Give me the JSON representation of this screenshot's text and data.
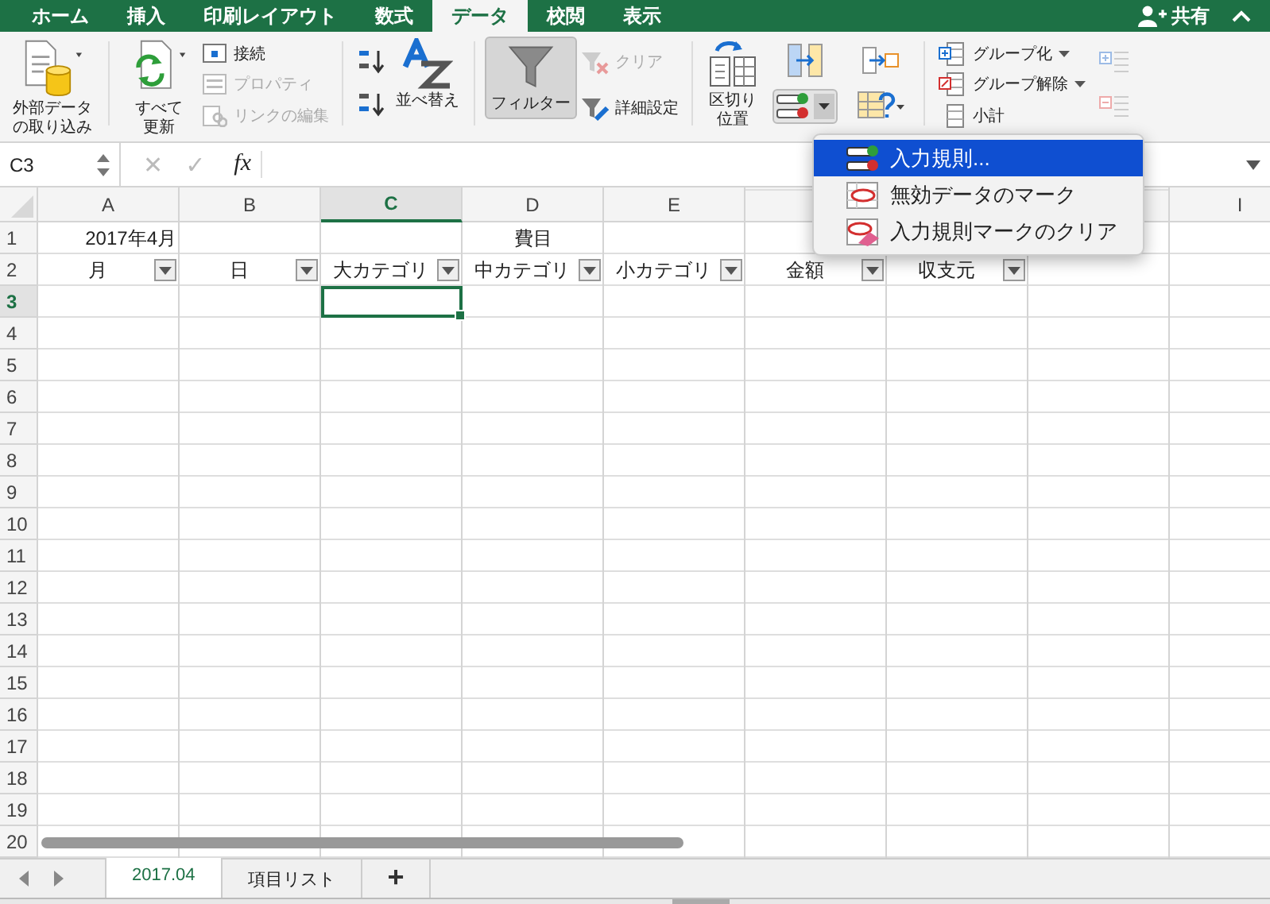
{
  "tabs": [
    {
      "label": "ホーム",
      "selected": false
    },
    {
      "label": "挿入",
      "selected": false
    },
    {
      "label": "印刷レイアウト",
      "selected": false
    },
    {
      "label": "数式",
      "selected": false
    },
    {
      "label": "データ",
      "selected": true
    },
    {
      "label": "校閲",
      "selected": false
    },
    {
      "label": "表示",
      "selected": false
    }
  ],
  "share": {
    "label": "共有"
  },
  "ribbon": {
    "get_external": {
      "label": "外部データの取り込み"
    },
    "refresh_all": {
      "label": "すべて更新"
    },
    "connections": [
      {
        "label": "接続",
        "disabled": false
      },
      {
        "label": "プロパティ",
        "disabled": true
      },
      {
        "label": "リンクの編集",
        "disabled": true
      }
    ],
    "sort": {
      "label": "並べ替え"
    },
    "filter": {
      "label": "フィルター",
      "selected": true
    },
    "clear": {
      "label": "クリア",
      "disabled": true
    },
    "advanced": {
      "label": "詳細設定",
      "disabled": false
    },
    "text_to_columns": {
      "label": "区切り位置"
    },
    "data_validation": {
      "expanded": true
    },
    "outline": [
      {
        "label": "グループ化",
        "dropdown": true
      },
      {
        "label": "グループ解除",
        "dropdown": true
      },
      {
        "label": "小計",
        "dropdown": false
      }
    ]
  },
  "formula_bar": {
    "name_box": "C3",
    "cancel": "✕",
    "enter": "✓",
    "fx": "fx"
  },
  "columns": [
    {
      "label": "A",
      "selected": false
    },
    {
      "label": "B",
      "selected": false
    },
    {
      "label": "C",
      "selected": true
    },
    {
      "label": "D",
      "selected": false
    },
    {
      "label": "E",
      "selected": false
    },
    {},
    {},
    {},
    {
      "label": "I",
      "selected": false
    }
  ],
  "rows": [
    {
      "label": "1",
      "selected": false,
      "cells": [
        {
          "text": "2017年4月",
          "kind": "date"
        },
        {},
        {},
        {
          "text": "費目"
        }
      ]
    },
    {
      "label": "2",
      "selected": false,
      "cells": [
        {
          "text": "月",
          "filter": true
        },
        {
          "text": "日",
          "filter": true
        },
        {
          "text": "大カテゴリ",
          "filter": true
        },
        {
          "text": "中カテゴリ",
          "filter": true
        },
        {
          "text": "小カテゴリ",
          "filter": true
        },
        {
          "text": "金額",
          "filter": true
        },
        {
          "text": "収支元",
          "filter": true
        }
      ]
    },
    {
      "label": "3",
      "selected": true,
      "cells": [
        {},
        {},
        {
          "selected": true
        }
      ]
    },
    {
      "label": "4",
      "selected": false,
      "cells": []
    },
    {
      "label": "5",
      "selected": false,
      "cells": []
    },
    {
      "label": "6",
      "selected": false,
      "cells": []
    },
    {
      "label": "7",
      "selected": false,
      "cells": []
    },
    {
      "label": "8",
      "selected": false,
      "cells": []
    },
    {
      "label": "9",
      "selected": false,
      "cells": []
    },
    {
      "label": "10",
      "selected": false,
      "cells": []
    },
    {
      "label": "11",
      "selected": false,
      "cells": []
    },
    {
      "label": "12",
      "selected": false,
      "cells": []
    },
    {
      "label": "13",
      "selected": false,
      "cells": []
    },
    {
      "label": "14",
      "selected": false,
      "cells": []
    },
    {
      "label": "15",
      "selected": false,
      "cells": []
    },
    {
      "label": "16",
      "selected": false,
      "cells": []
    },
    {
      "label": "17",
      "selected": false,
      "cells": []
    },
    {
      "label": "18",
      "selected": false,
      "cells": []
    },
    {
      "label": "19",
      "selected": false,
      "cells": []
    },
    {
      "label": "20",
      "selected": false,
      "cells": []
    }
  ],
  "validation_menu": {
    "items": [
      {
        "label": "入力規則...",
        "selected": true
      },
      {
        "label": "無効データのマーク",
        "selected": false
      },
      {
        "label": "入力規則マークのクリア",
        "selected": false
      }
    ]
  },
  "sheets": [
    {
      "label": "2017.04",
      "selected": true
    },
    {
      "label": "項目リスト",
      "selected": false
    }
  ],
  "add_sheet": "+"
}
